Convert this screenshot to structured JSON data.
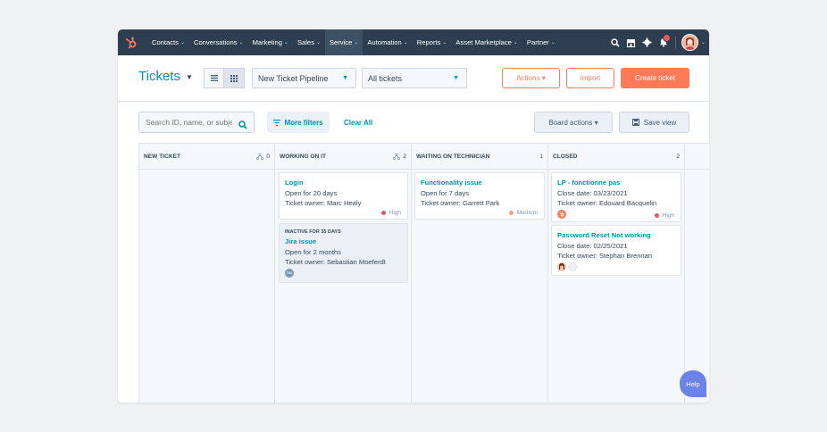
{
  "nav": {
    "items": [
      {
        "label": "Contacts"
      },
      {
        "label": "Conversations"
      },
      {
        "label": "Marketing"
      },
      {
        "label": "Sales"
      },
      {
        "label": "Service",
        "active": true
      },
      {
        "label": "Automation"
      },
      {
        "label": "Reports"
      },
      {
        "label": "Asset Marketplace"
      },
      {
        "label": "Partner"
      }
    ],
    "chevron": "⌄",
    "notification_count": ""
  },
  "header": {
    "title": "Tickets",
    "title_caret": "▼",
    "pipeline": "New Ticket Pipeline",
    "view_filter": "All tickets",
    "actions_label": "Actions ▾",
    "import_label": "Import",
    "create_label": "Create ticket",
    "caret": "▼"
  },
  "filters": {
    "search_placeholder": "Search ID, name, or subject",
    "more_filters": "More filters",
    "clear_all": "Clear All",
    "board_actions": "Board actions ▾",
    "save_view": "Save view"
  },
  "columns": [
    {
      "name": "NEW TICKET",
      "count": "0",
      "show_icon": true
    },
    {
      "name": "WORKING ON IT",
      "count": "2",
      "show_icon": true
    },
    {
      "name": "WAITING ON TECHNICIAN",
      "count": "1",
      "show_icon": false
    },
    {
      "name": "CLOSED",
      "count": "2",
      "show_icon": false
    }
  ],
  "cards": {
    "login": {
      "name": "Login",
      "line1": "Open for 20 days",
      "line2": "Ticket owner: Marc Healy",
      "priority": "High"
    },
    "jira": {
      "inactive": "INACTIVE FOR 35 DAYS",
      "name": "Jira issue",
      "line1": "Open for 2 months",
      "line2": "Ticket owner: Sebastian Moeferdt",
      "avatar": "SM"
    },
    "functionality": {
      "name": "Functionality issue",
      "line1": "Open for 7 days",
      "line2": "Ticket owner: Garrett Park",
      "priority": "Medium"
    },
    "lp": {
      "name": "LP - fonctionne pas",
      "line1": "Close date: 03/23/2021",
      "line2": "Ticket owner: Edouard Bacquelin",
      "priority": "High"
    },
    "password": {
      "name": "Password Reset Not working",
      "line1": "Close date: 02/25/2021",
      "line2": "Ticket owner: Stephan Brennan"
    }
  },
  "help_label": "Help",
  "colors": {
    "nav_bg": "#2d3e50",
    "accent_teal": "#0091ae",
    "accent_orange": "#ff7a59",
    "high_dot": "#f2545b",
    "help_bg": "#6d82e8"
  }
}
